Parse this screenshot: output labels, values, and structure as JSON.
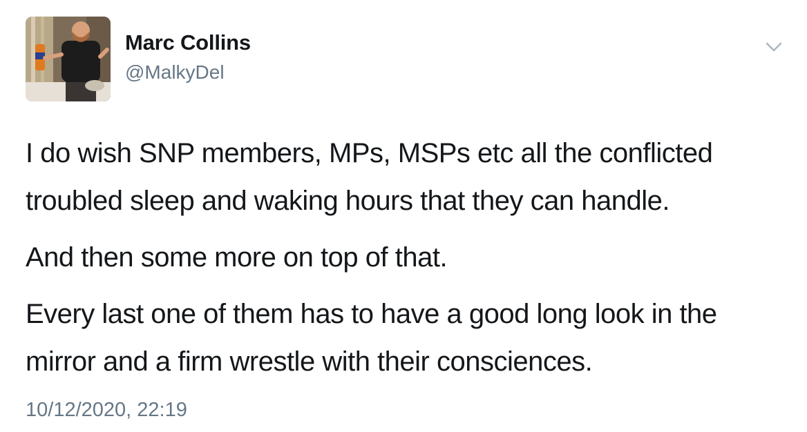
{
  "tweet": {
    "author": {
      "display_name": "Marc Collins",
      "handle": "@MalkyDel",
      "avatar": "profile-photo"
    },
    "menu_icon": "chevron-down-icon",
    "paragraphs": [
      "I do wish SNP members, MPs, MSPs etc all the conflicted troubled sleep and waking hours that they can handle.",
      "And then some more on top of that.",
      "Every last one of them has to have a good long look in the mirror and a firm wrestle with their consciences."
    ],
    "timestamp": "10/12/2020, 22:19"
  },
  "colors": {
    "text_primary": "#14171a",
    "text_secondary": "#657786",
    "chevron": "#aab8c2",
    "background": "#ffffff"
  }
}
